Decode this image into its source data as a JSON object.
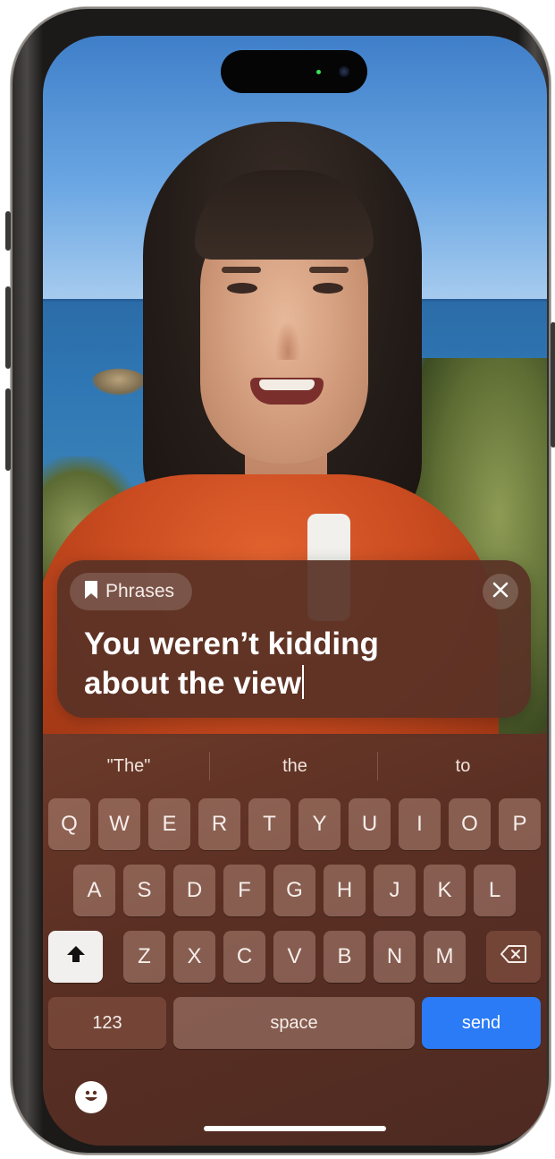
{
  "phrase_card": {
    "chip_label": "Phrases",
    "chip_icon": "bookmark-icon",
    "close_icon": "close-icon",
    "line1": "You weren’t kidding",
    "line2": "about the view"
  },
  "suggestions": [
    "\"The\"",
    "the",
    "to"
  ],
  "keyboard": {
    "row1": [
      "Q",
      "W",
      "E",
      "R",
      "T",
      "Y",
      "U",
      "I",
      "O",
      "P"
    ],
    "row2": [
      "A",
      "S",
      "D",
      "F",
      "G",
      "H",
      "J",
      "K",
      "L"
    ],
    "row3": [
      "Z",
      "X",
      "C",
      "V",
      "B",
      "N",
      "M"
    ],
    "numbers_label": "123",
    "space_label": "space",
    "send_label": "send",
    "shift_icon": "shift-icon",
    "delete_icon": "delete-icon",
    "emoji_icon": "emoji-icon"
  },
  "colors": {
    "send_key": "#2a7bf5",
    "keyboard_bg": "#5a2f23"
  }
}
